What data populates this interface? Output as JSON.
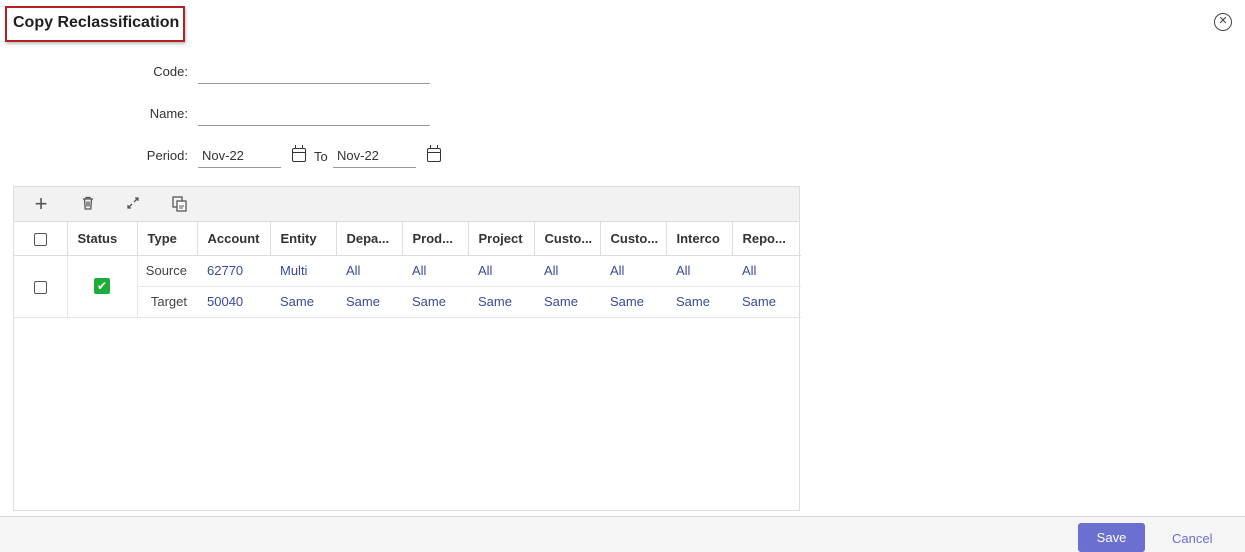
{
  "dialog": {
    "title": "Copy Reclassification",
    "close_icon": "close-circle-icon"
  },
  "form": {
    "code_label": "Code:",
    "code_value": "",
    "name_label": "Name:",
    "name_value": "",
    "period_label": "Period:",
    "period_from": "Nov-22",
    "to_label": "To",
    "period_to": "Nov-22"
  },
  "toolbar": {
    "icons": [
      "plus-icon",
      "trash-icon",
      "link-icon",
      "copy-icon"
    ]
  },
  "table": {
    "headers": [
      "Status",
      "Type",
      "Account",
      "Entity",
      "Depa...",
      "Prod...",
      "Project",
      "Custo...",
      "Custo...",
      "Interco",
      "Repo..."
    ],
    "rows": [
      {
        "status": "checked",
        "source": {
          "type": "Source",
          "cells": [
            "62770",
            "Multi",
            "All",
            "All",
            "All",
            "All",
            "All",
            "All",
            "All"
          ]
        },
        "target": {
          "type": "Target",
          "cells": [
            "50040",
            "Same",
            "Same",
            "Same",
            "Same",
            "Same",
            "Same",
            "Same",
            "Same"
          ]
        }
      }
    ]
  },
  "footer": {
    "save_label": "Save",
    "cancel_label": "Cancel"
  },
  "colors": {
    "accent": "#6a6fd0",
    "status_ok": "#1fad3a",
    "link_text": "#3a4a9a",
    "title_border": "#b22222"
  }
}
